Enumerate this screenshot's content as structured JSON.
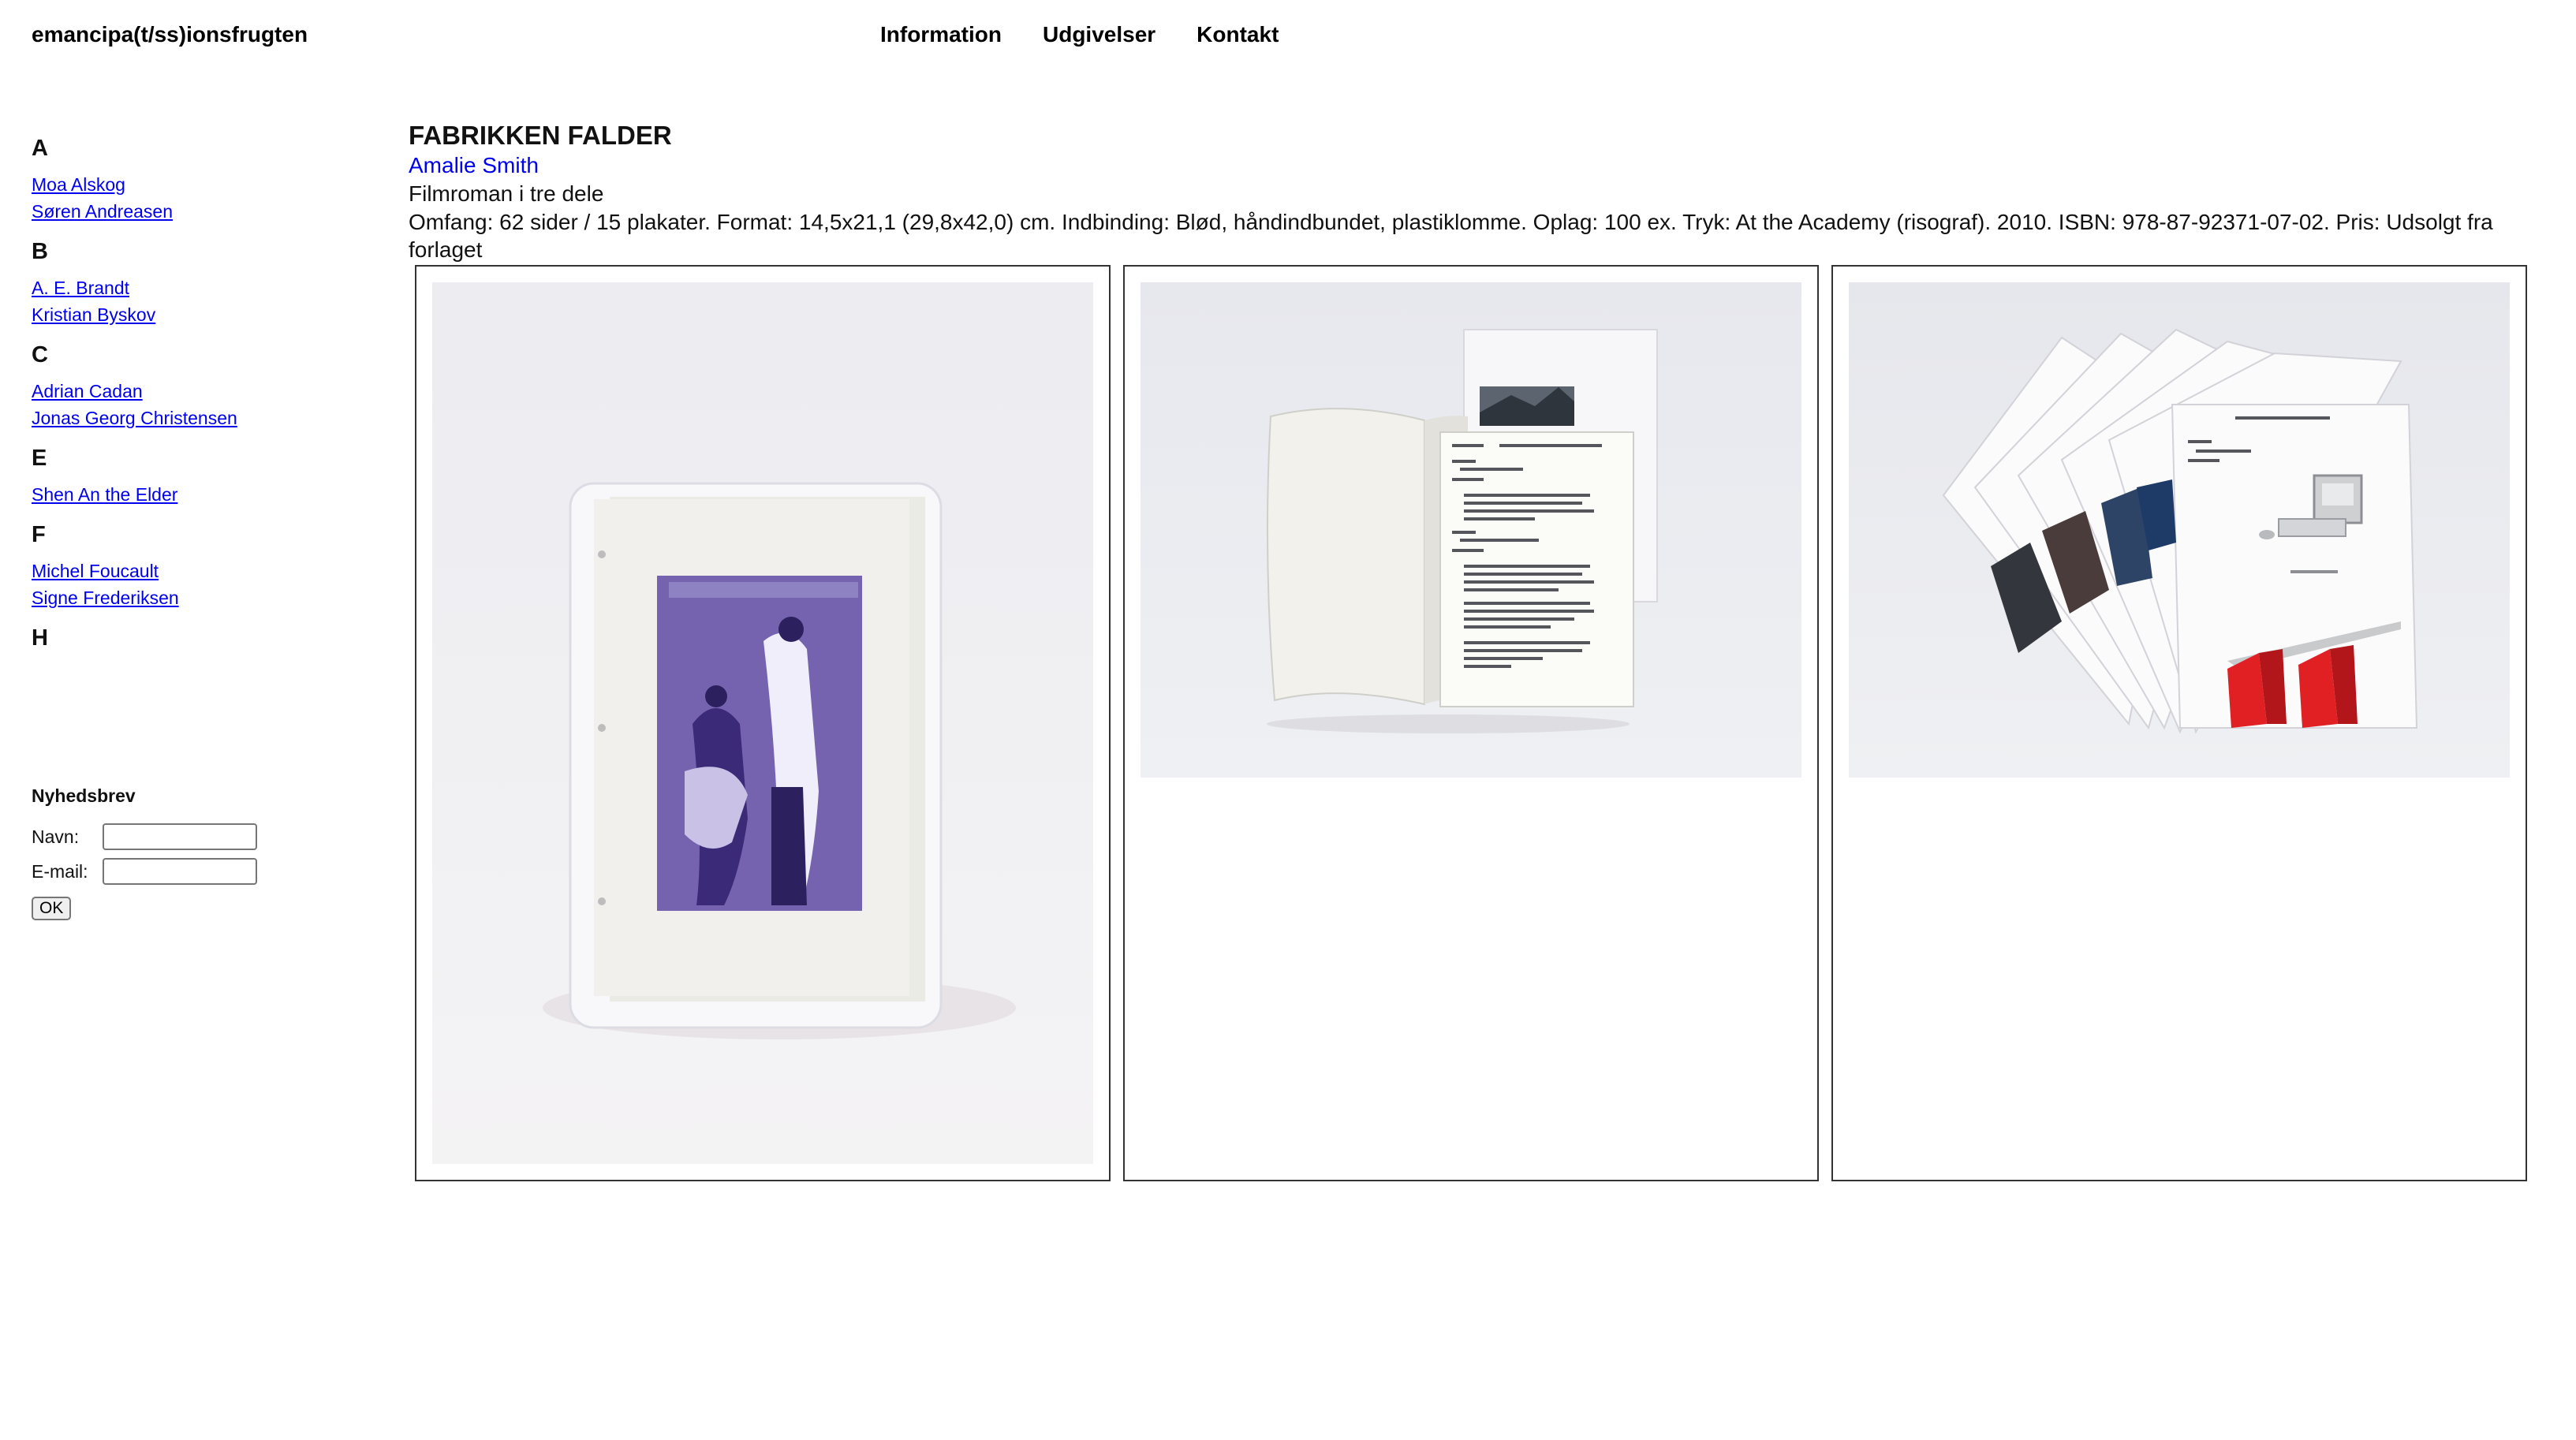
{
  "header": {
    "site_title": "emancipa(t/ss)ionsfrugten",
    "nav": [
      "Information",
      "Udgivelser",
      "Kontakt"
    ]
  },
  "index": {
    "groups": [
      {
        "letter": "A",
        "authors": [
          "Moa Alskog",
          "Søren Andreasen"
        ]
      },
      {
        "letter": "B",
        "authors": [
          "A. E. Brandt",
          "Kristian Byskov"
        ]
      },
      {
        "letter": "C",
        "authors": [
          "Adrian Cadan",
          "Jonas Georg Christensen"
        ]
      },
      {
        "letter": "E",
        "authors": [
          "Shen An the Elder"
        ]
      },
      {
        "letter": "F",
        "authors": [
          "Michel Foucault",
          "Signe Frederiksen"
        ]
      },
      {
        "letter": "H",
        "authors": []
      }
    ]
  },
  "newsletter": {
    "title": "Nyhedsbrev",
    "name_label": "Navn:",
    "email_label": "E-mail:",
    "ok_label": "OK",
    "name_value": "",
    "email_value": ""
  },
  "book": {
    "title": "FABRIKKEN FALDER",
    "author": "Amalie Smith",
    "subtitle": "Filmroman i tre dele",
    "details": "Omfang: 62 sider / 15 plakater. Format: 14,5x21,1 (29,8x42,0) cm. Indbinding: Blød, håndindbundet, plastiklomme. Oplag: 100 ex. Tryk: At the Academy (risograf). 2010. ISBN: 978-87-92371-07-02. Pris: Udsolgt fra forlaget"
  },
  "gallery": [
    {
      "image": "book-in-plastic-sleeve"
    },
    {
      "image": "open-book-with-screenplay"
    },
    {
      "image": "fanned-posters"
    }
  ],
  "colors": {
    "link": "#0000ee",
    "text": "#111111",
    "border": "#333333",
    "photo_background": "#eeeef0"
  }
}
